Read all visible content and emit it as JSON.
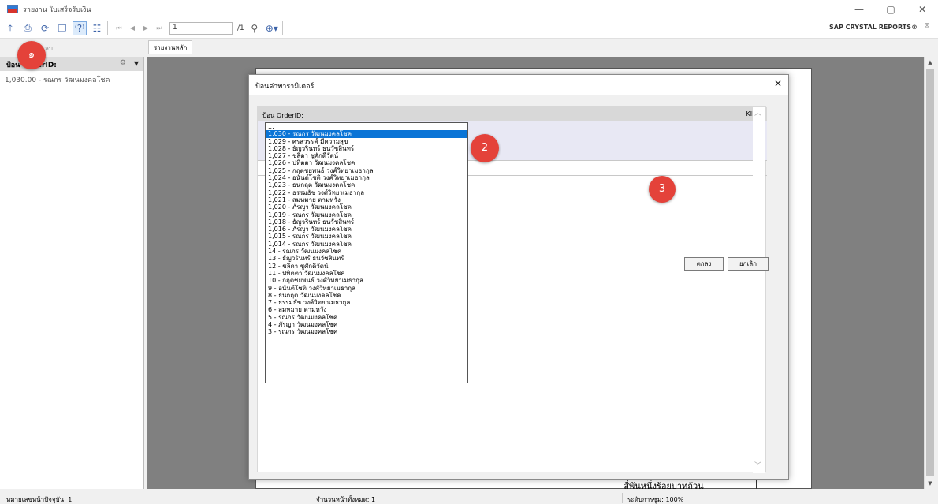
{
  "window": {
    "title": "รายงาน ใบเสร็จรับเงิน",
    "minimize": "—",
    "maximize": "▢",
    "close": "✕"
  },
  "toolbar": {
    "page_value": "1",
    "page_total": "/1",
    "brand": "SAP CRYSTAL REPORTS®"
  },
  "subbar": {
    "delete_label": "ลบ",
    "tab_main": "รายงานหลัก"
  },
  "left_panel": {
    "header": "ป้อน OrderID:",
    "items": [
      "1,030.00 - รณกร วัฒนมงคลโชค"
    ]
  },
  "report": {
    "footer_text": "สี่พันหนึ่งร้อยบาทถ้วน"
  },
  "status": {
    "current_page": "หมายเลขหน้าปัจจุบัน: 1",
    "total_pages": "จำนวนหน้าทั้งหมด: 1",
    "zoom": "ระดับการซูม: 100%"
  },
  "dialog": {
    "title": "ป้อนค่าพารามิเตอร์",
    "param_label": "ป้อน OrderID:",
    "param_right": "KILL",
    "ok_label": "ตกลง",
    "cancel_label": "ยกเลิก"
  },
  "dropdown": {
    "items": [
      "...",
      "1,030 - รณกร วัฒนมงคลโชค",
      "1,029 - ศรสวรรค์ มีความสุข",
      "1,028 - ธัญวรินทร์ ธนวัชสินทร์",
      "1,027 - ชลิดา ชูศักดิ์วัตน์",
      "1,026 - ปทิตตา วัฒนมงคลโชค",
      "1,025 - กฤตชยพนธ์ วงศ์วิทยาเมธากุล",
      "1,024 - อนันต์โชติ วงศ์วิทยาเมธากุล",
      "1,023 - ธนกฤต วัฒนมงคลโชค",
      "1,022 - ธรรมธัช วงศ์วิทยาเมธากุล",
      "1,021 - สมหมาย ตามหวัง",
      "1,020 - ภัรญา วัฒนมงคลโชค",
      "1,019 - รณกร วัฒนมงคลโชค",
      "1,018 - ธัญวรินทร์ ธนวัชสินทร์",
      "1,016 - ภัรญา วัฒนมงคลโชค",
      "1,015 - รณกร วัฒนมงคลโชค",
      "1,014 - รณกร วัฒนมงคลโชค",
      "14 - รณกร วัฒนมงคลโชค",
      "13 - ธัญวรินทร์ ธนวัชสินทร์",
      "12 - ชลิดา ชูศักดิ์วัตน์",
      "11 - ปทิตตา วัฒนมงคลโชค",
      "10 - กฤตชยพนธ์ วงศ์วิทยาเมธากุล",
      "9 - อนันต์โชติ วงศ์วิทยาเมธากุล",
      "8 - ธนกฤต วัฒนมงคลโชค",
      "7 - ธรรมธัช วงศ์วิทยาเมธากุล",
      "6 - สมหมาย ตามหวัง",
      "5 - รณกร วัฒนมงคลโชค",
      "4 - ภัรญา วัฒนมงคลโชค",
      "3 - รณกร วัฒนมงคลโชค"
    ],
    "selected_index": 1
  },
  "callouts": {
    "one": "๑",
    "two": "2",
    "three": "3"
  },
  "colors": {
    "selection": "#0a74d6",
    "callout": "#e4423a"
  }
}
